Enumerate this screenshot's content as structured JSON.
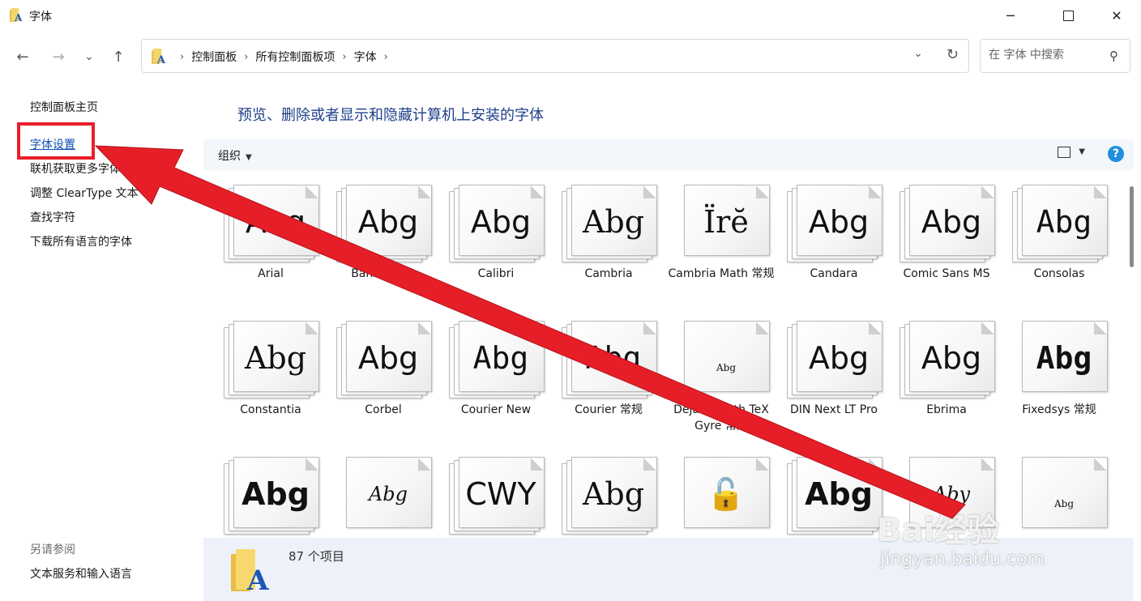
{
  "window": {
    "title": "字体"
  },
  "nav": {
    "back": "←",
    "forward": "→",
    "recent": "⌄",
    "up": "↑"
  },
  "address": {
    "crumbs": [
      "控制面板",
      "所有控制面板项",
      "字体"
    ]
  },
  "search": {
    "placeholder": "在 字体 中搜索"
  },
  "sidebar": {
    "items": [
      "控制面板主页",
      "字体设置",
      "联机获取更多字体",
      "调整 ClearType 文本",
      "查找字符",
      "下载所有语言的字体"
    ],
    "see_also_title": "另请参阅",
    "see_also_items": [
      "文本服务和输入语言"
    ]
  },
  "main": {
    "heading": "预览、删除或者显示和隐藏计算机上安装的字体",
    "toolbar": {
      "organize": "组织",
      "help": "?"
    }
  },
  "fonts": [
    {
      "name": "Arial",
      "sample": "Abg"
    },
    {
      "name": "Bahnschrift",
      "sample": "Abg"
    },
    {
      "name": "Calibri",
      "sample": "Abg"
    },
    {
      "name": "Cambria",
      "sample": "Abg"
    },
    {
      "name": "Cambria Math 常规",
      "sample": "Ïrĕ"
    },
    {
      "name": "Candara",
      "sample": "Abg"
    },
    {
      "name": "Comic Sans MS",
      "sample": "Abg"
    },
    {
      "name": "Consolas",
      "sample": "Abg"
    },
    {
      "name": "Constantia",
      "sample": "Abg"
    },
    {
      "name": "Corbel",
      "sample": "Abg"
    },
    {
      "name": "Courier New",
      "sample": "Abg"
    },
    {
      "name": "Courier 常规",
      "sample": "Abg"
    },
    {
      "name": "DejaVu Math TeX Gyre 常规",
      "sample": "Abg"
    },
    {
      "name": "DIN Next LT Pro",
      "sample": "Abg"
    },
    {
      "name": "Ebrima",
      "sample": "Abg"
    },
    {
      "name": "Fixedsys 常规",
      "sample": "Abg"
    },
    {
      "name": "",
      "sample": "Abg"
    },
    {
      "name": "",
      "sample": "Abg"
    },
    {
      "name": "",
      "sample": "CWY"
    },
    {
      "name": "",
      "sample": "Abg"
    },
    {
      "name": "",
      "sample": "🔓"
    },
    {
      "name": "",
      "sample": "Abg"
    },
    {
      "name": "",
      "sample": "Aby"
    },
    {
      "name": "",
      "sample": "Abg"
    }
  ],
  "status": {
    "count": "87 个项目"
  },
  "watermark": {
    "text": "Bai经验",
    "url": "jingyan.baidu.com"
  },
  "colors": {
    "highlight": "#ea1f2a",
    "link": "#0b4db6",
    "heading": "#1e3f8a"
  }
}
